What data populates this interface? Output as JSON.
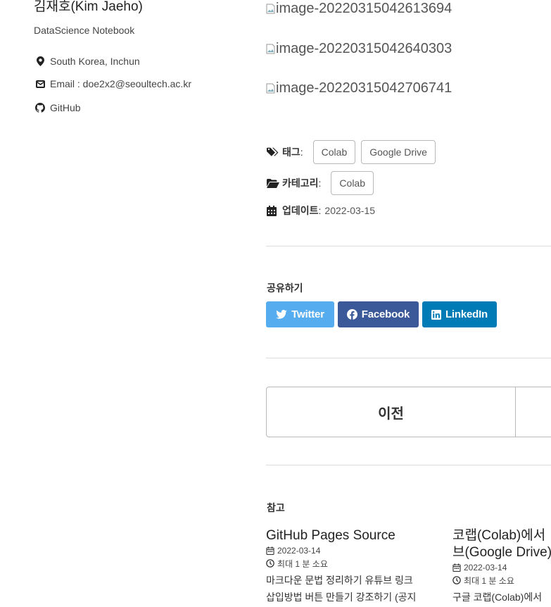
{
  "sidebar": {
    "author_name": "김재호(Kim Jaeho)",
    "bio": "DataScience Notebook",
    "location": "South Korea, Inchun",
    "email": "Email : doe2x2@seoultech.ac.kr",
    "github": "GitHub"
  },
  "images": [
    "image-20220315042613694",
    "image-20220315042640303",
    "image-20220315042706741"
  ],
  "meta": {
    "tags_label": "태그",
    "tags": [
      "Colab",
      "Google Drive"
    ],
    "category_label": "카테고리",
    "categories": [
      "Colab"
    ],
    "updated_label": "업데이트",
    "updated_date": "2022-03-15"
  },
  "share": {
    "title": "공유하기",
    "twitter": "Twitter",
    "facebook": "Facebook",
    "linkedin": "LinkedIn",
    "colors": {
      "twitter": "#55acee",
      "facebook": "#3b5998",
      "linkedin": "#007bb6"
    }
  },
  "pager": {
    "prev": "이전"
  },
  "related": {
    "title": "참고",
    "posts": [
      {
        "title": "GitHub Pages Source",
        "date": "2022-03-14",
        "read_time": "최대 1 분 소요",
        "excerpt_1": "마크다운 문법 정리하기 유튜브 링크",
        "excerpt_2": "삽입방법 버튼 만들기 강조하기 (공지"
      },
      {
        "title_1": "코랩(Colab)에서",
        "title_2": "브(Google Drive)",
        "date": "2022-03-14",
        "read_time": "최대 1 분 소요",
        "excerpt": "구글 코랩(Colab)에서"
      }
    ]
  }
}
